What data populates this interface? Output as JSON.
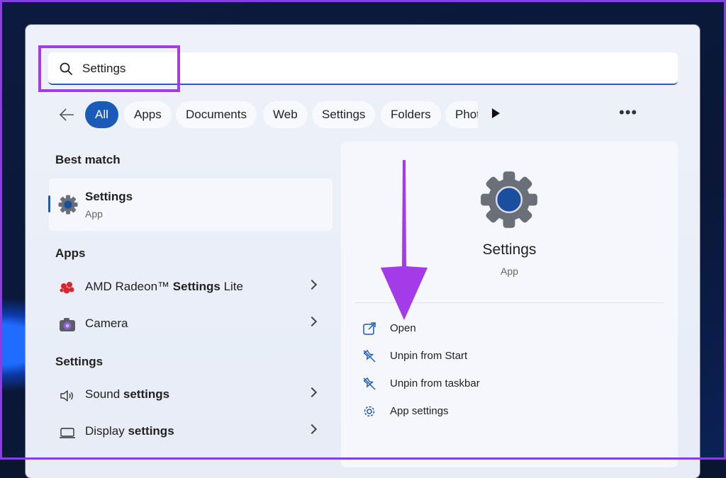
{
  "search": {
    "value": "Settings"
  },
  "filters": [
    {
      "label": "All",
      "active": true
    },
    {
      "label": "Apps"
    },
    {
      "label": "Documents"
    },
    {
      "label": "Web"
    },
    {
      "label": "Settings"
    },
    {
      "label": "Folders"
    },
    {
      "label": "Phot"
    }
  ],
  "sections": {
    "best_match": "Best match",
    "apps": "Apps",
    "settings": "Settings"
  },
  "best_match": {
    "title": "Settings",
    "subtitle": "App"
  },
  "apps": [
    {
      "pre": "AMD Radeon™ ",
      "bold": "Settings",
      "post": " Lite"
    },
    {
      "pre": "Camera",
      "bold": "",
      "post": ""
    }
  ],
  "settings_results": [
    {
      "pre": "Sound ",
      "bold": "settings"
    },
    {
      "pre": "Display ",
      "bold": "settings"
    }
  ],
  "detail": {
    "title": "Settings",
    "subtitle": "App",
    "actions": [
      {
        "label": "Open",
        "icon": "open-external-icon"
      },
      {
        "label": "Unpin from Start",
        "icon": "unpin-icon"
      },
      {
        "label": "Unpin from taskbar",
        "icon": "unpin-icon"
      },
      {
        "label": "App settings",
        "icon": "gear-icon"
      }
    ]
  },
  "colors": {
    "accent": "#1a5ab8",
    "annotation": "#a43be8"
  }
}
